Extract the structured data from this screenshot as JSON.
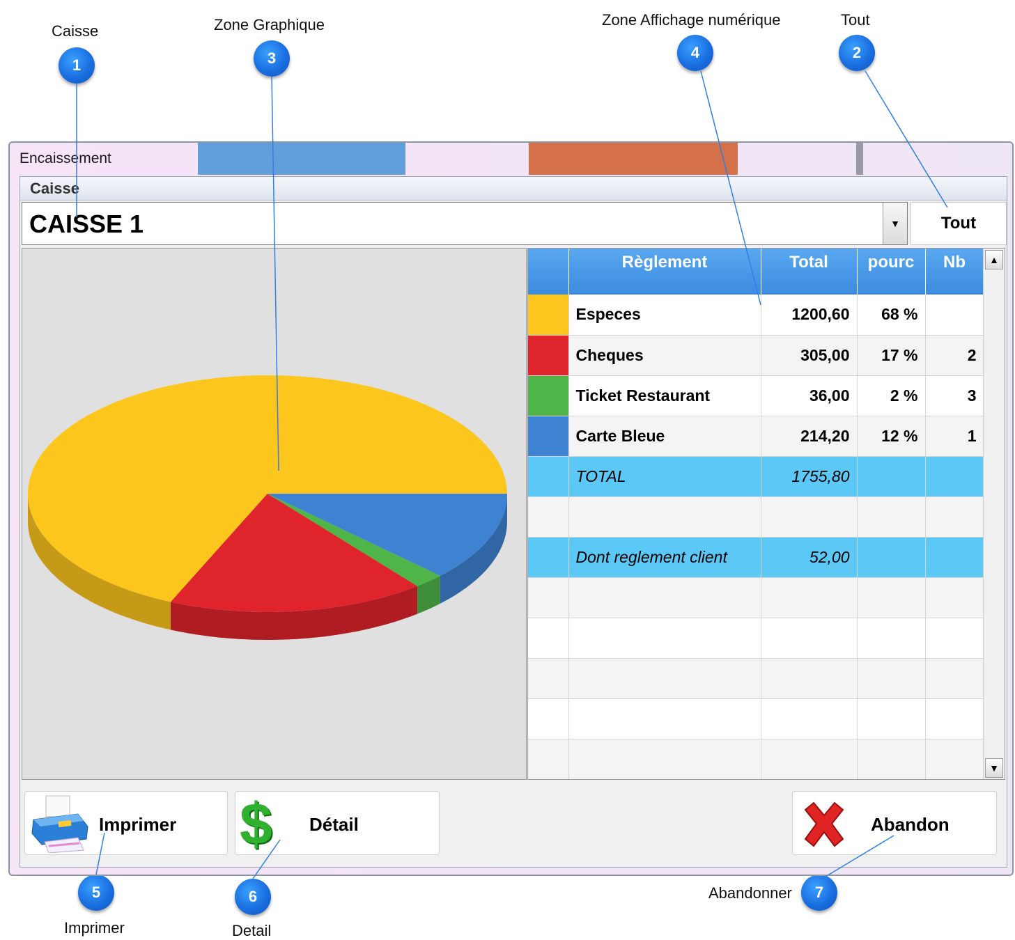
{
  "callouts": [
    {
      "number": "1",
      "label": "Caisse"
    },
    {
      "number": "2",
      "label": "Tout"
    },
    {
      "number": "3",
      "label": "Zone Graphique"
    },
    {
      "number": "4",
      "label": "Zone Affichage numérique"
    },
    {
      "number": "5",
      "label": "Imprimer"
    },
    {
      "number": "6",
      "label": "Detail"
    },
    {
      "number": "7",
      "label": "Abandonner"
    }
  ],
  "window": {
    "title": "Encaissement",
    "group_label": "Caisse",
    "register_select_value": "CAISSE 1",
    "all_button_label": "Tout"
  },
  "grid": {
    "headers": [
      "Règlement",
      "Total",
      "pourc",
      "Nb"
    ],
    "rows": [
      {
        "label": "Especes",
        "total": "1200,60",
        "pct": "68 %",
        "nb": "",
        "color": "#fcc61d"
      },
      {
        "label": "Cheques",
        "total": "305,00",
        "pct": "17 %",
        "nb": "2",
        "color": "#e0242c"
      },
      {
        "label": "Ticket Restaurant",
        "total": "36,00",
        "pct": "2 %",
        "nb": "3",
        "color": "#4fb549"
      },
      {
        "label": "Carte Bleue",
        "total": "214,20",
        "pct": "12 %",
        "nb": "1",
        "color": "#3d83d2"
      }
    ],
    "total_label": "TOTAL",
    "total_value": "1755,80",
    "client_label": "Dont reglement client",
    "client_value": "52,00"
  },
  "chart_data": {
    "type": "pie",
    "categories": [
      "Especes",
      "Cheques",
      "Ticket Restaurant",
      "Carte Bleue"
    ],
    "values": [
      1200.6,
      305.0,
      36.0,
      214.2
    ],
    "colors": [
      "#fcc61d",
      "#e0242c",
      "#4fb549",
      "#3d83d2"
    ]
  },
  "buttons": {
    "print_label": "Imprimer",
    "detail_label": "Détail",
    "cancel_label": "Abandon"
  },
  "icons": {
    "print": "printer-icon",
    "detail": "dollar-icon",
    "cancel": "red-x-icon"
  }
}
